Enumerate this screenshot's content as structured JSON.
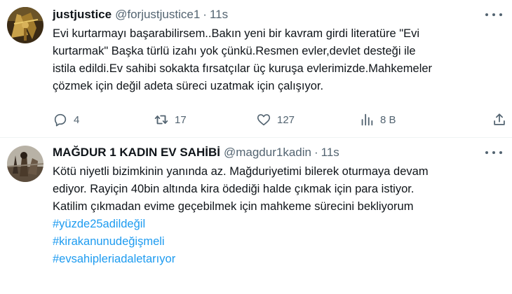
{
  "tweets": [
    {
      "name": "justjustice",
      "handle": "@forjustjustice1",
      "separator": "·",
      "time": "11s",
      "lines": [
        "Evi kurtarmayı başarabilirsem..Bakın yeni bir kavram girdi literatüre \"Evi",
        "kurtarmak\" Başka türlü izahı yok çünkü.Resmen evler,devlet desteği ile",
        "istila edildi.Ev sahibi sokakta fırsatçılar üç kuruşa evlerimizde.Mahkemeler",
        "çözmek için değil adeta süreci uzatmak için çalışıyor."
      ],
      "stats": {
        "replies": "4",
        "retweets": "17",
        "likes": "127",
        "views": "8 B"
      }
    },
    {
      "name": "MAĞDUR 1 KADIN EV SAHİBİ",
      "handle": "@magdur1kadin",
      "separator": "·",
      "time": "11s",
      "lines": [
        "Kötü niyetli  bizimkinin yanında az. Mağduriyetimi bilerek oturmaya devam",
        "ediyor. Rayiçin 40bin altında kira ödediği halde çıkmak için para istiyor.",
        "Katilim çıkmadan evime geçebilmek için mahkeme sürecini bekliyorum"
      ],
      "hashtags": [
        "#yüzde25adildeğil",
        "#kirakanunudeğişmeli",
        "#evsahipleriadaletarıyor"
      ]
    }
  ],
  "icons": {
    "reply": "reply-icon",
    "retweet": "retweet-icon",
    "like": "heart-icon",
    "views": "views-icon",
    "share": "share-icon",
    "more": "more-icon"
  },
  "colors": {
    "text": "#0f1419",
    "secondary": "#536471",
    "hashtag": "#1d9bf0",
    "divider": "#eff3f4"
  }
}
